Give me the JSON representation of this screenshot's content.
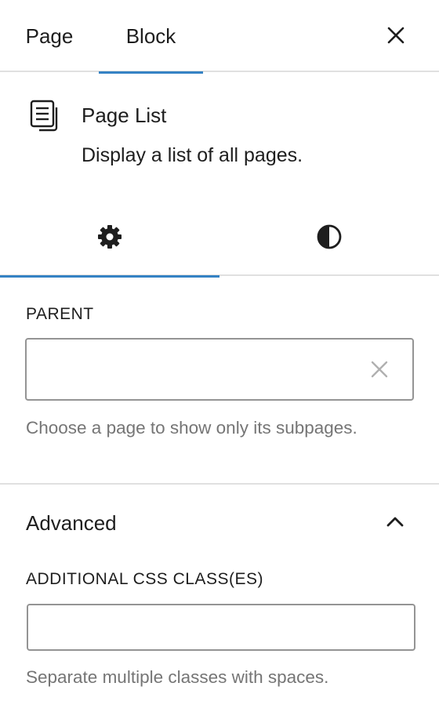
{
  "header": {
    "tabs": [
      {
        "label": "Page"
      },
      {
        "label": "Block"
      }
    ],
    "active_tab": "Block",
    "close_icon": "close-icon"
  },
  "block_card": {
    "icon": "page-list-icon",
    "title": "Page List",
    "description": "Display a list of all pages."
  },
  "subtabs": {
    "items": [
      {
        "icon": "gear-icon",
        "label": "Settings"
      },
      {
        "icon": "contrast-icon",
        "label": "Styles"
      }
    ],
    "active": "Settings"
  },
  "parent": {
    "label": "PARENT",
    "value": "",
    "clear_icon": "clear-icon",
    "help": "Choose a page to show only its subpages."
  },
  "advanced": {
    "title": "Advanced",
    "expanded": true,
    "chevron_icon": "chevron-up-icon",
    "css_label": "ADDITIONAL CSS CLASS(ES)",
    "css_value": "",
    "css_help": "Separate multiple classes with spaces."
  },
  "colors": {
    "accent": "#3582c4",
    "text": "#1e1e1e",
    "muted": "#757575",
    "border": "#949494",
    "divider": "#e0e0e0"
  }
}
